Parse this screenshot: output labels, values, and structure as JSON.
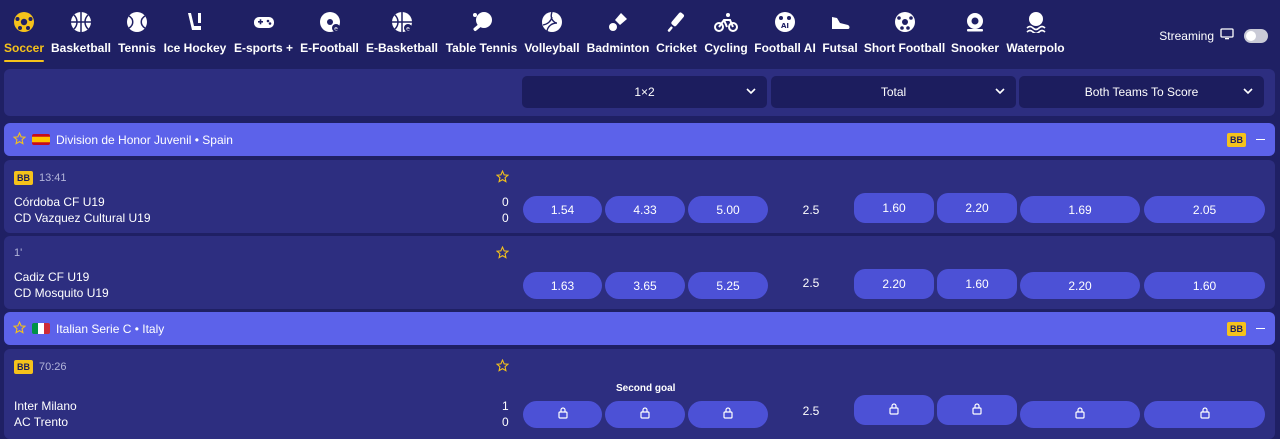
{
  "nav": {
    "sports": [
      {
        "label": "Soccer",
        "icon": "soccer-ball-icon"
      },
      {
        "label": "Basketball",
        "icon": "basketball-icon"
      },
      {
        "label": "Tennis",
        "icon": "tennis-ball-icon"
      },
      {
        "label": "Ice Hockey",
        "icon": "hockey-stick-icon"
      },
      {
        "label": "E-sports +",
        "icon": "gamepad-icon"
      },
      {
        "label": "E-Football",
        "icon": "e-football-icon"
      },
      {
        "label": "E-Basketball",
        "icon": "e-basketball-icon"
      },
      {
        "label": "Table Tennis",
        "icon": "table-tennis-paddle-icon"
      },
      {
        "label": "Volleyball",
        "icon": "volleyball-icon"
      },
      {
        "label": "Badminton",
        "icon": "shuttlecock-icon"
      },
      {
        "label": "Cricket",
        "icon": "cricket-bat-icon"
      },
      {
        "label": "Cycling",
        "icon": "bicycle-icon"
      },
      {
        "label": "Football AI",
        "icon": "football-ai-icon"
      },
      {
        "label": "Futsal",
        "icon": "futsal-shoe-icon"
      },
      {
        "label": "Short Football",
        "icon": "short-football-icon"
      },
      {
        "label": "Snooker",
        "icon": "snooker-icon"
      },
      {
        "label": "Waterpolo",
        "icon": "waterpolo-icon"
      }
    ],
    "streaming_label": "Streaming"
  },
  "markets": {
    "m1": "1×2",
    "m2": "Total",
    "m3": "Both Teams To Score"
  },
  "leagues": [
    {
      "name": "Division de Honor Juvenil • Spain",
      "badge": "BB",
      "matches": [
        {
          "badge": "BB",
          "time": "13:41",
          "home": "Córdoba CF U19",
          "away": "CD Vazquez Cultural U19",
          "home_score": "0",
          "away_score": "0",
          "odds_1x2": [
            "1.54",
            "4.33",
            "5.00"
          ],
          "total_line": "2.5",
          "total": [
            "1.60",
            "2.20"
          ],
          "btts": [
            "1.69",
            "2.05"
          ]
        },
        {
          "time": "1'",
          "home": "Cadiz CF U19",
          "away": "CD Mosquito U19",
          "odds_1x2": [
            "1.63",
            "3.65",
            "5.25"
          ],
          "total_line": "2.5",
          "total": [
            "2.20",
            "1.60"
          ],
          "btts": [
            "2.20",
            "1.60"
          ]
        }
      ]
    },
    {
      "name": "Italian Serie C • Italy",
      "badge": "BB",
      "matches": [
        {
          "badge": "BB",
          "time": "70:26",
          "home": "Inter Milano",
          "away": "AC Trento",
          "home_score": "1",
          "away_score": "0",
          "market_note": "Second goal",
          "total_line": "2.5",
          "locked": true
        }
      ]
    }
  ],
  "colors": {
    "background": "#1f2064",
    "panel": "#2d2e80",
    "league_bar": "#5c62ea",
    "odd_button": "#4c51d6",
    "accent": "#f5c21b"
  }
}
